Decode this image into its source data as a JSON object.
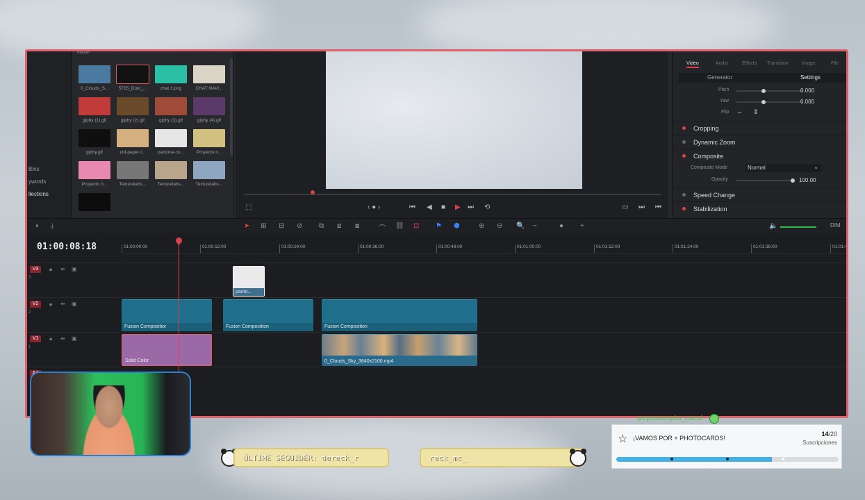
{
  "media": {
    "master": "Master",
    "bins": [
      "Bins",
      "Keywords",
      "Collections"
    ],
    "bins_display": [
      "Bins",
      "ywords",
      "llections"
    ],
    "thumbnails": [
      {
        "name": "0_Clouds_S...",
        "selected": false
      },
      {
        "name": "5715_Dust_...",
        "selected": true
      },
      {
        "name": "chat 3.png",
        "selected": false
      },
      {
        "name": "CHAT NAVI...",
        "selected": false
      },
      {
        "name": "giphy (1).gif",
        "selected": false
      },
      {
        "name": "giphy (2).gif",
        "selected": false
      },
      {
        "name": "giphy (3).gif",
        "selected": false
      },
      {
        "name": "giphy (4).gif",
        "selected": false
      },
      {
        "name": "giphy.gif",
        "selected": false
      },
      {
        "name": "old-paper-t...",
        "selected": false
      },
      {
        "name": "pantone-co...",
        "selected": false
      },
      {
        "name": "Proyecto n...",
        "selected": false
      },
      {
        "name": "Proyecto n...",
        "selected": false
      },
      {
        "name": "Texturelabs...",
        "selected": false
      },
      {
        "name": "Texturelabs...",
        "selected": false
      },
      {
        "name": "Texturelabs...",
        "selected": false
      },
      {
        "name": "",
        "selected": false
      }
    ]
  },
  "inspector": {
    "tabs": [
      "Video",
      "Audio",
      "Effects",
      "Transition",
      "Image",
      "File"
    ],
    "active_tab": "Video",
    "subtabs": [
      "Generator",
      "Settings"
    ],
    "pitch_label": "Pitch",
    "pitch_value": "0.000",
    "yaw_label": "Yaw",
    "yaw_value": "0.000",
    "flip_label": "Flip",
    "sections": [
      "Cropping",
      "Dynamic Zoom",
      "Composite",
      "Speed Change",
      "Stabilization"
    ],
    "composite_mode_label": "Composite Mode",
    "composite_mode_value": "Normal",
    "opacity_label": "Opacity",
    "opacity_value": "100.00"
  },
  "timeline": {
    "timecode": "01:00:08:18",
    "ruler": [
      "01:00:00:00",
      "01:00:12:00",
      "01:00:24:00",
      "01:00:36:00",
      "01:00:48:00",
      "01:01:00:00",
      "01:01:12:00",
      "01:01:24:00",
      "01:01:36:00",
      "01:01:48"
    ],
    "tracks": [
      {
        "name": "V3",
        "num": "3"
      },
      {
        "name": "V2",
        "num": "2"
      },
      {
        "name": "V1",
        "num": "1"
      },
      {
        "name": "A1",
        "num": ""
      }
    ],
    "clips": {
      "v3_clip": "panto...",
      "fusion": "Fusion Composition",
      "fusion_1": "Fusion Compositior",
      "solid": "Solid Color",
      "video": "0_Clouds_Sky_3840x2160.mp4"
    },
    "dim_label": "DIM"
  },
  "overlay": {
    "last_follower": "ÚLTIME SEGUIDER: dereck_r",
    "follower_scroll": "reck_mc_",
    "handle": "pepecompta_oscal",
    "goal_title": "¡VAMOS POR + PHOTOCARDS!",
    "goal_current": "14",
    "goal_total": "/20",
    "goal_subtitle": "Suscripciones",
    "goal_progress": 0.7
  },
  "colors": {
    "accent_red": "#e0404a",
    "frame_border": "#e0606a",
    "fusion_clip": "#1f6f8c",
    "solid_clip": "#9b6aa6",
    "goal_fill": "#45b1e3"
  }
}
